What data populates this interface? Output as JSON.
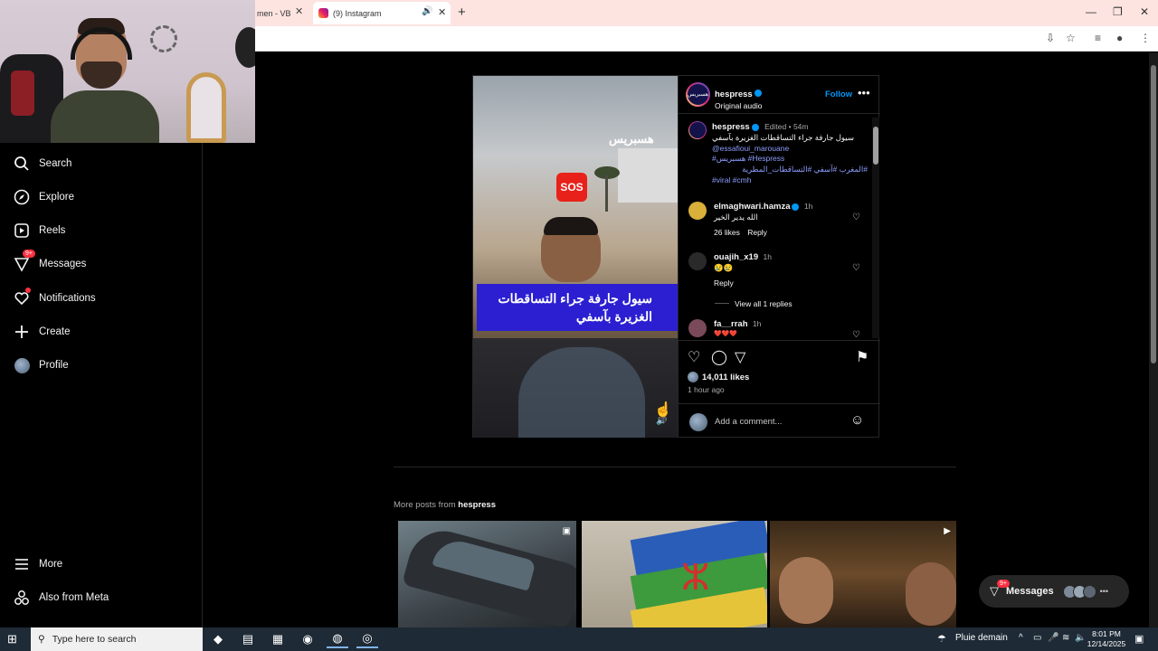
{
  "browser": {
    "prev_tab_title": "men - VB",
    "active_tab_title": "(9) Instagram",
    "new_tab_label": "+"
  },
  "sidebar": {
    "items": [
      {
        "label": "Search",
        "icon": "search-icon"
      },
      {
        "label": "Explore",
        "icon": "compass-icon"
      },
      {
        "label": "Reels",
        "icon": "reels-icon"
      },
      {
        "label": "Messages",
        "icon": "messenger-icon",
        "badge": "9+"
      },
      {
        "label": "Notifications",
        "icon": "heart-icon",
        "dot": true
      },
      {
        "label": "Create",
        "icon": "plus-icon"
      },
      {
        "label": "Profile",
        "icon": "avatar"
      }
    ],
    "more_label": "More",
    "meta_label": "Also from Meta"
  },
  "post": {
    "media": {
      "logo_text": "هسبريس",
      "sos_text": "SOS",
      "caption_text": "سيول جارفة جراء التساقطات الغزيرة بآسفي"
    },
    "header": {
      "username": "hespress",
      "subtitle": "Original audio",
      "follow_label": "Follow",
      "avatar_text": "هسبريس"
    },
    "caption": {
      "username": "hespress",
      "edited": "Edited",
      "time": "54m",
      "text": "سيول جارفة جراء التساقطات الغزيرة بآسفي",
      "mention": "@essafioui_marouane",
      "tags_line1": "#هسبريس #Hespress",
      "tags_line2": "#المغرب #آسفي #التساقطات_المطرية",
      "tags_line3": "#viral #cmh"
    },
    "comments": [
      {
        "username": "elmaghwari.hamza",
        "time": "1h",
        "text": "الله يدير الخير",
        "likes": "26 likes",
        "reply": "Reply"
      },
      {
        "username": "ouajih_x19",
        "time": "1h",
        "text": "😢😢",
        "reply": "Reply",
        "view_replies": "View all 1 replies"
      },
      {
        "username": "fa__rrah",
        "time": "1h",
        "text": "❤️❤️❤️"
      }
    ],
    "likes": "14,011 likes",
    "posted": "1 hour ago",
    "add_comment_placeholder": "Add a comment..."
  },
  "more_posts": {
    "prefix": "More posts from",
    "username": "hespress"
  },
  "messages_pill": {
    "label": "Messages",
    "badge": "9+"
  },
  "taskbar": {
    "search_placeholder": "Type here to search",
    "weather": "Pluie demain",
    "time": "8:01 PM",
    "date": "12/14/2025"
  }
}
